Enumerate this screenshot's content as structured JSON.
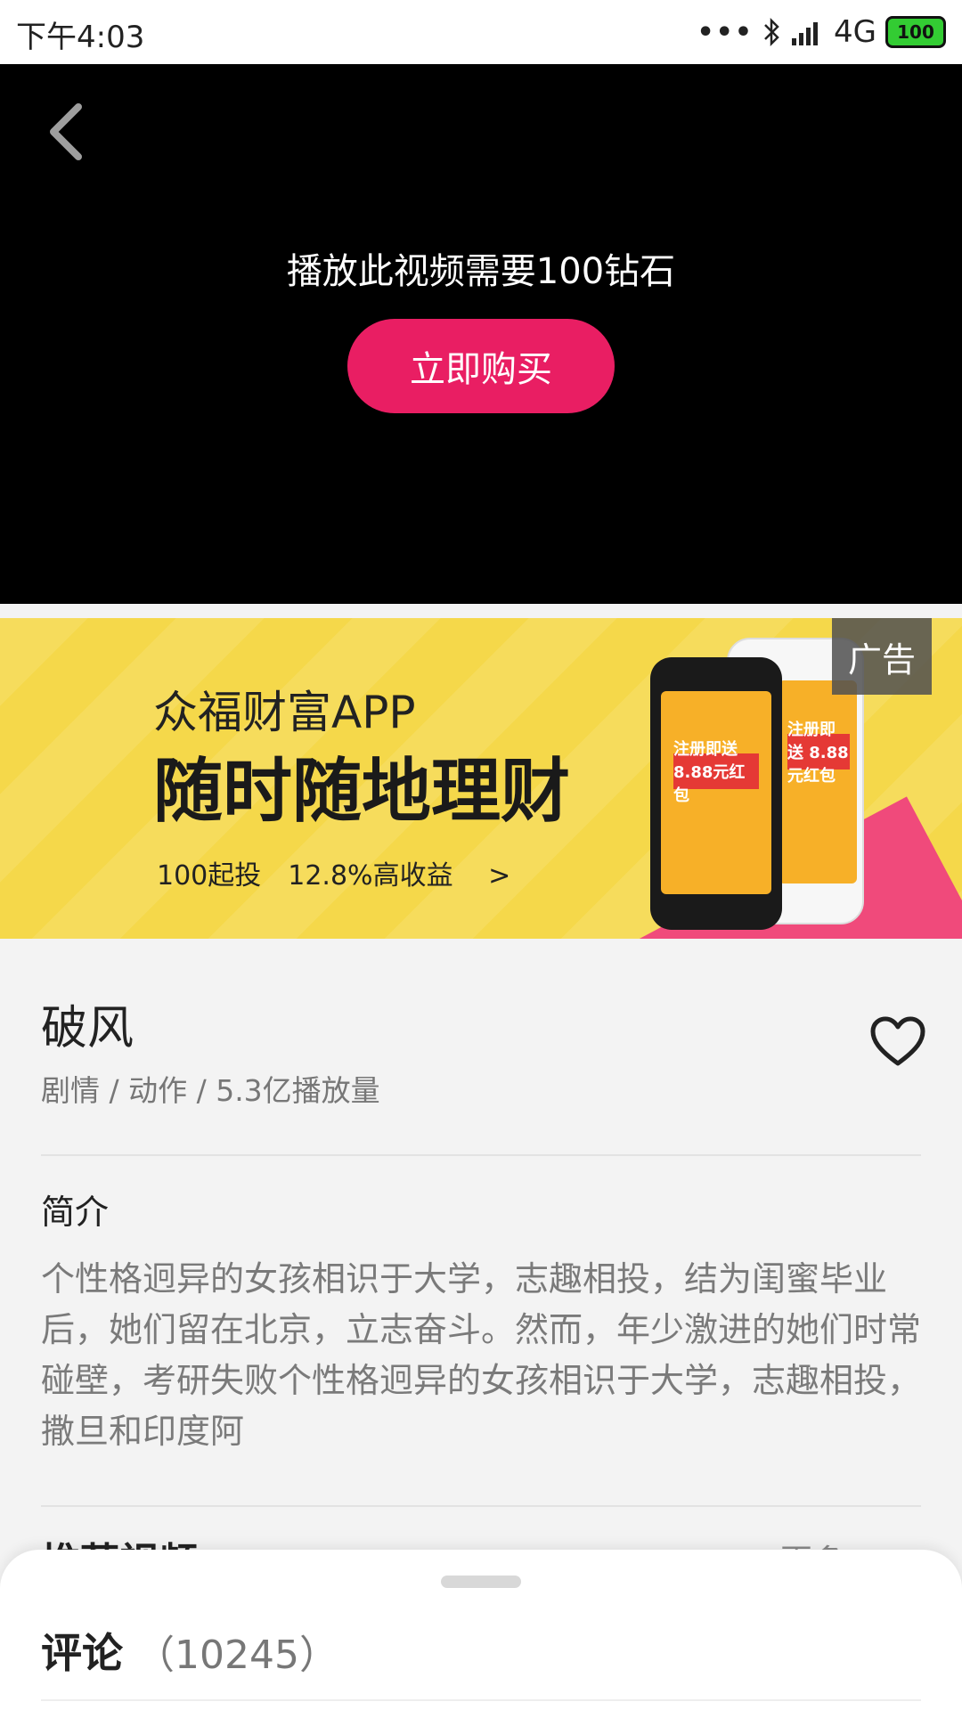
{
  "status": {
    "time": "下午4:03",
    "network": "4G",
    "battery": "100"
  },
  "video": {
    "message": "播放此视频需要100钻石",
    "buy_label": "立即购买"
  },
  "ad": {
    "badge": "广告",
    "title": "众福财富APP",
    "headline": "随时随地理财",
    "sub": "100起投　12.8%高收益　 >",
    "phone_promo": "注册即送 8.88元红包"
  },
  "movie": {
    "title": "破风",
    "meta": "剧情 / 动作 / 5.3亿播放量",
    "synopsis_label": "简介",
    "synopsis": "个性格迥异的女孩相识于大学，志趣相投，结为闺蜜毕业后，她们留在北京，立志奋斗。然而，年少激进的她们时常碰壁，考研失败个性格迥异的女孩相识于大学，志趣相投，撒旦和印度阿"
  },
  "recommend": {
    "title": "推荐视频",
    "more": "更多 >"
  },
  "comments": {
    "label": "评论",
    "count": "（10245）"
  }
}
